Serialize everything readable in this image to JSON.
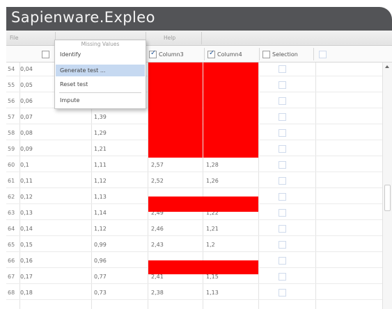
{
  "window": {
    "title": "Sapienware.Expleo"
  },
  "menu": {
    "file": "File",
    "missing_values": "Missing Values",
    "help": "Help"
  },
  "dropdown": {
    "title": "Missing Values",
    "items": [
      {
        "label": "Identify",
        "highlighted": false
      },
      {
        "label": "Generate test ...",
        "highlighted": true
      },
      {
        "label": "Reset test",
        "highlighted": false
      },
      {
        "label": "Impute",
        "highlighted": false
      }
    ]
  },
  "columns": {
    "col1_checked": false,
    "col3": {
      "label": "Column3",
      "checked": true
    },
    "col4": {
      "label": "Column4",
      "checked": true
    },
    "selection": {
      "label": "Selection",
      "checked": false
    }
  },
  "rows": [
    {
      "idx": "54",
      "c1": "0,04",
      "c2": "",
      "c3": "",
      "c4": ""
    },
    {
      "idx": "55",
      "c1": "0,05",
      "c2": "",
      "c3": "",
      "c4": ""
    },
    {
      "idx": "56",
      "c1": "0,06",
      "c2": "",
      "c3": "",
      "c4": ""
    },
    {
      "idx": "57",
      "c1": "0,07",
      "c2": "1,39",
      "c3": "",
      "c4": ""
    },
    {
      "idx": "58",
      "c1": "0,08",
      "c2": "1,29",
      "c3": "",
      "c4": ""
    },
    {
      "idx": "59",
      "c1": "0,09",
      "c2": "1,21",
      "c3": "",
      "c4": ""
    },
    {
      "idx": "60",
      "c1": "0,1",
      "c2": "1,11",
      "c3": "2,57",
      "c4": "1,28"
    },
    {
      "idx": "61",
      "c1": "0,11",
      "c2": "1,12",
      "c3": "2,52",
      "c4": "1,26"
    },
    {
      "idx": "62",
      "c1": "0,12",
      "c2": "1,13",
      "c3": "",
      "c4": ""
    },
    {
      "idx": "63",
      "c1": "0,13",
      "c2": "1,14",
      "c3": "2,49",
      "c4": "1,22"
    },
    {
      "idx": "64",
      "c1": "0,14",
      "c2": "1,12",
      "c3": "2,46",
      "c4": "1,21"
    },
    {
      "idx": "65",
      "c1": "0,15",
      "c2": "0,99",
      "c3": "2,43",
      "c4": "1,2"
    },
    {
      "idx": "66",
      "c1": "0,16",
      "c2": "0,96",
      "c3": "",
      "c4": ""
    },
    {
      "idx": "67",
      "c1": "0,17",
      "c2": "0,77",
      "c3": "2,41",
      "c4": "1,15"
    },
    {
      "idx": "68",
      "c1": "0,18",
      "c2": "0,73",
      "c3": "2,38",
      "c4": "1,13"
    }
  ],
  "missing_value_color": "#ff0000",
  "icons": {
    "scroll_up": "scroll-up-arrow-icon"
  }
}
